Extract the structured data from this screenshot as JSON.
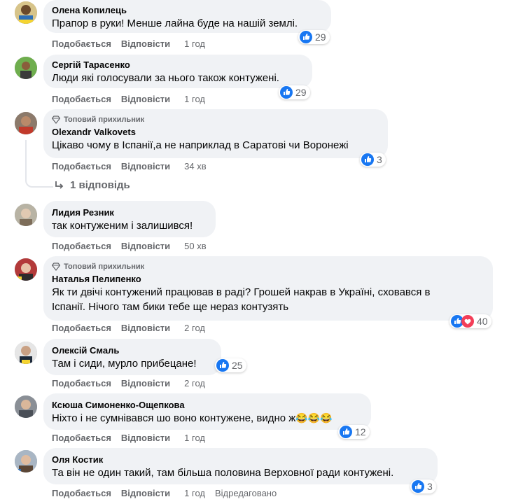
{
  "labels": {
    "like": "Подобається",
    "reply": "Відповісти",
    "top_fan": "Топовий прихильник",
    "edited": "Відредаговано"
  },
  "comments": [
    {
      "author": "Олена Копилець",
      "text": "Прапор в руки! Менше лайна буде на нашій землі.",
      "time": "1 год",
      "reactions": "29",
      "reaction_types": [
        "like"
      ]
    },
    {
      "author": "Сергій Тарасенко",
      "text": "Люди які голосували за нього також контужені.",
      "time": "1 год",
      "reactions": "29",
      "reaction_types": [
        "like"
      ]
    },
    {
      "author": "Olexandr Valkovets",
      "badge": "Топовий прихильник",
      "text": "Цікаво чому в Іспанії,а не наприклад в Саратові чи Воронежі",
      "time": "34 хв",
      "reactions": "3",
      "reaction_types": [
        "like"
      ],
      "replies_label": "1 відповідь"
    },
    {
      "author": "Лидия Резник",
      "text": "так контуженим і залишився!",
      "time": "50 хв"
    },
    {
      "author": "Наталья Пелипенко",
      "badge": "Топовий прихильник",
      "text_lines": [
        "Як ти двічі контужений працював в раді? Грошей накрав в Україні, сховався в",
        "Іспанії. Нічого там бики тебе ще нераз контузять"
      ],
      "time": "2 год",
      "reactions": "40",
      "reaction_types": [
        "like",
        "love"
      ]
    },
    {
      "author": "Олексій Смаль",
      "text": "Там і сиди, мурло прибецане!",
      "time": "2 год",
      "reactions": "25",
      "reaction_types": [
        "like"
      ]
    },
    {
      "author": "Ксюша Симоненко-Ощепкова",
      "text": "Ніхто і не сумнівався шо воно контужене, видно ж",
      "emoji": "😂😂😂",
      "time": "1 год",
      "reactions": "12",
      "reaction_types": [
        "like"
      ]
    },
    {
      "author": "Оля Костик",
      "text": "Та він не один такий, там більша половина Верховної ради контужені.",
      "time": "1 год",
      "reactions": "3",
      "reaction_types": [
        "like"
      ],
      "edited": true
    }
  ],
  "colors": {
    "bubble": "#f0f2f5",
    "like_blue": "#1877f2",
    "love_red": "#f33e58",
    "meta_gray": "#65676b"
  },
  "icons": {
    "like": "like-reaction-icon",
    "love": "love-reaction-icon",
    "top_fan": "diamond-icon",
    "reply_arrow": "reply-arrow-icon"
  }
}
